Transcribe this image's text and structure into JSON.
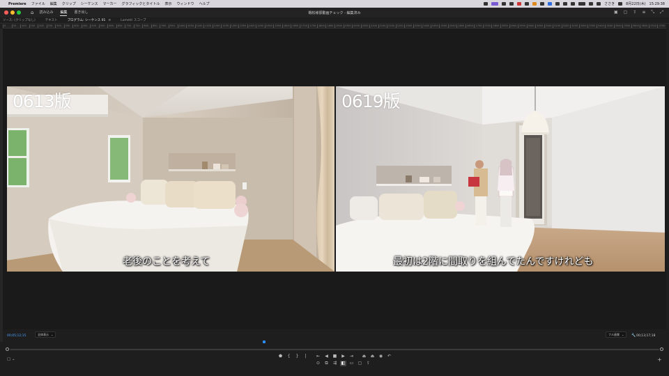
{
  "menubar": {
    "apple": "",
    "app_name": "Premiere",
    "items": [
      "ファイル",
      "編集",
      "クリップ",
      "シーケンス",
      "マーカー",
      "グラフィックとタイトル",
      "表示",
      "ウィンドウ",
      "ヘルプ"
    ],
    "status_user": "ささき",
    "date": "8月22日(木)",
    "time": "15:29:38"
  },
  "header": {
    "workspaces": [
      "読み込み",
      "編集",
      "書き出し"
    ],
    "active_workspace": "編集",
    "doc_title": "戦松様邸動画チェック - 編集済み"
  },
  "panel_tabs": [
    {
      "label": "ソース: (クリップなし)",
      "active": false
    },
    {
      "label": "テキスト",
      "active": false
    },
    {
      "label": "プログラム: シーケンス 01",
      "active": true,
      "menu": "≡"
    },
    {
      "label": "Lumetri スコープ",
      "active": false
    }
  ],
  "ruler_ticks": [
    "0",
    "50",
    "100",
    "150",
    "200",
    "250",
    "300",
    "350",
    "400",
    "450",
    "500",
    "550",
    "600",
    "650",
    "700",
    "750",
    "800",
    "850",
    "900",
    "950",
    "1000",
    "1050",
    "1100",
    "1150",
    "1200",
    "1250",
    "1300",
    "1350",
    "1400",
    "1450",
    "1500",
    "1550",
    "1600",
    "1650",
    "1700",
    "1750",
    "1800",
    "1850",
    "1900",
    "1950",
    "2000",
    "2050",
    "2100",
    "2150",
    "2200",
    "2250",
    "2300",
    "2350",
    "2400",
    "2450",
    "2500",
    "2550",
    "2600",
    "2650",
    "2700",
    "2750",
    "2800",
    "2850",
    "2900",
    "2950",
    "3000",
    "3050",
    "3100",
    "3150",
    "3200",
    "3250",
    "3300",
    "3350",
    "3400",
    "3450",
    "3500",
    "3550",
    "3600",
    "3650",
    "3700",
    "3750"
  ],
  "frames": {
    "left": {
      "label": "0613版",
      "subtitle": "老後のことを考えて"
    },
    "right": {
      "label": "0619版",
      "subtitle": "最初は2階に間取りを組んでたんですけれども"
    }
  },
  "controls": {
    "timecode_current": "00;05;12;15",
    "fit_label": "全体表示",
    "quality_label": "フル画質",
    "timecode_duration": "00;13;17;18",
    "playhead_position": 0.39
  },
  "colors": {
    "accent": "#2d8cff",
    "timecode": "#4aa3ff"
  }
}
